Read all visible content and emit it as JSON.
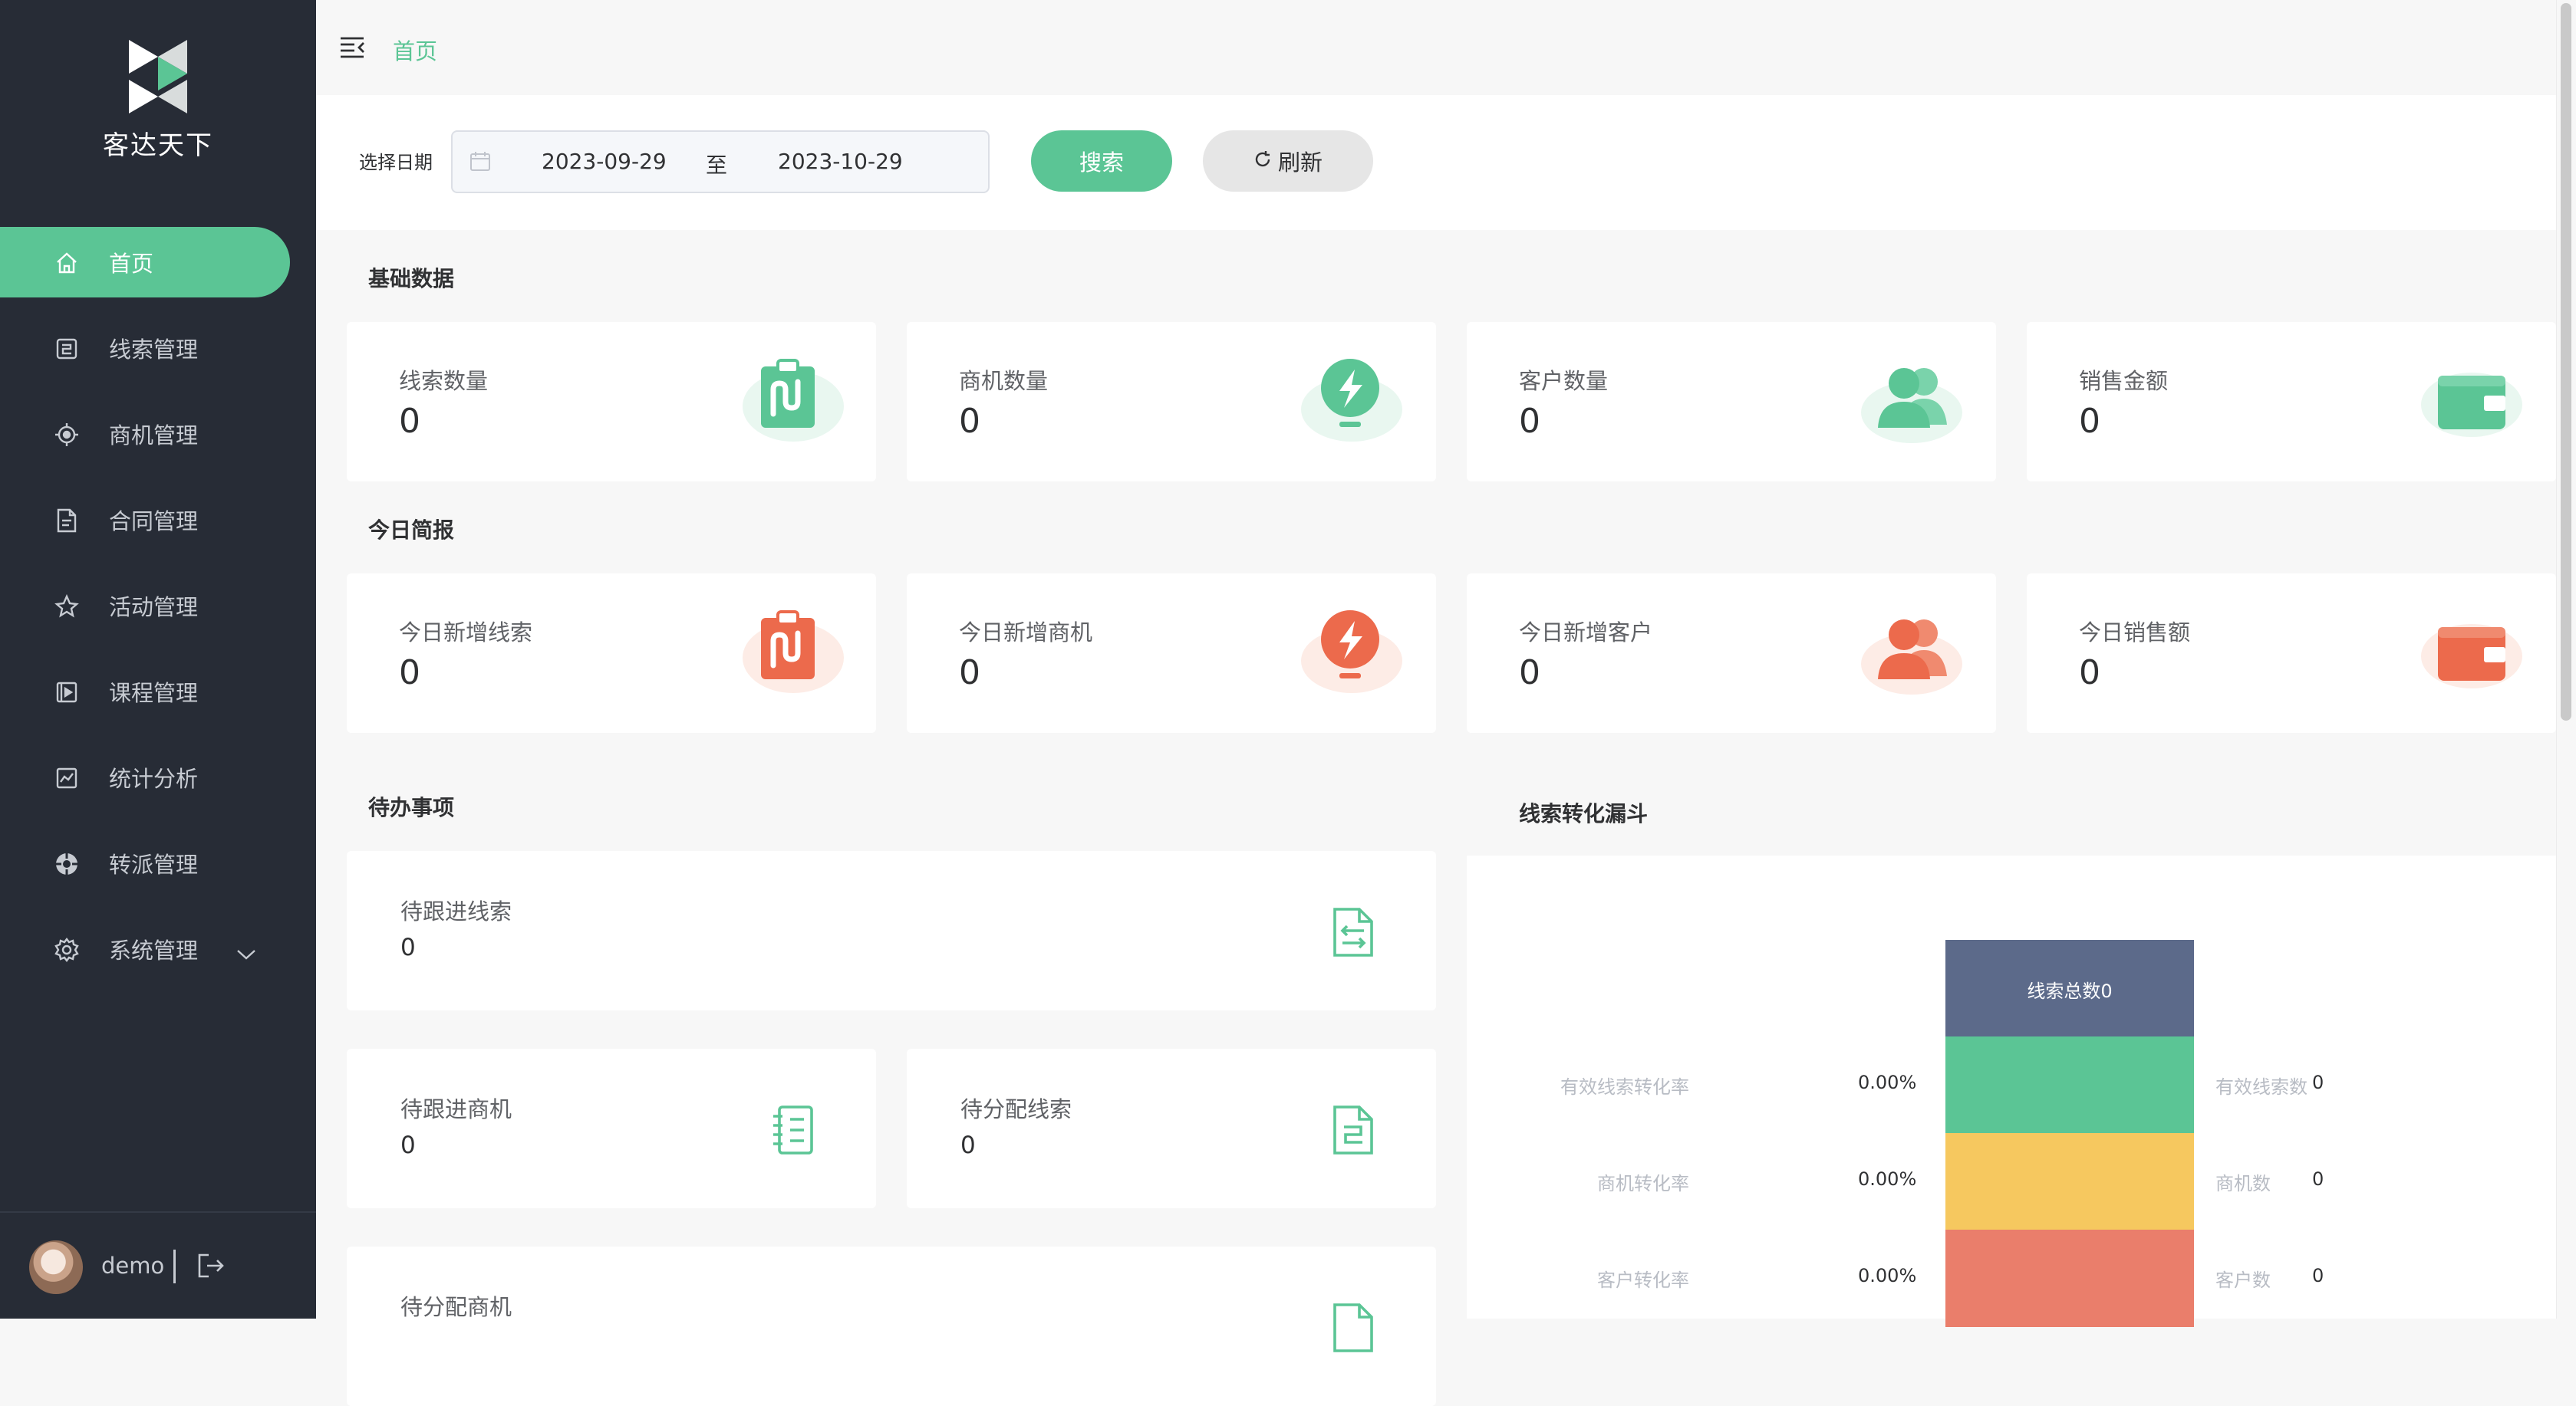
{
  "app": {
    "name": "客达天下"
  },
  "breadcrumb": {
    "current": "首页"
  },
  "sidebar": {
    "items": [
      {
        "label": "首页",
        "icon": "home-icon"
      },
      {
        "label": "线索管理",
        "icon": "clue-icon"
      },
      {
        "label": "商机管理",
        "icon": "target-icon"
      },
      {
        "label": "合同管理",
        "icon": "document-icon"
      },
      {
        "label": "活动管理",
        "icon": "star-icon"
      },
      {
        "label": "课程管理",
        "icon": "play-icon"
      },
      {
        "label": "统计分析",
        "icon": "chart-icon"
      },
      {
        "label": "转派管理",
        "icon": "transfer-icon"
      },
      {
        "label": "系统管理",
        "icon": "gear-icon"
      }
    ],
    "active_index": 0,
    "user": {
      "name": "demo"
    }
  },
  "filter": {
    "label": "选择日期",
    "start_date": "2023-09-29",
    "separator": "至",
    "end_date": "2023-10-29",
    "search_label": "搜索",
    "refresh_label": "刷新"
  },
  "basic": {
    "title": "基础数据",
    "cards": [
      {
        "label": "线索数量",
        "value": "0",
        "icon": "clipboard-icon"
      },
      {
        "label": "商机数量",
        "value": "0",
        "icon": "lightbulb-icon"
      },
      {
        "label": "客户数量",
        "value": "0",
        "icon": "users-icon"
      },
      {
        "label": "销售金额",
        "value": "0",
        "icon": "wallet-icon"
      }
    ]
  },
  "today": {
    "title": "今日简报",
    "cards": [
      {
        "label": "今日新增线索",
        "value": "0",
        "icon": "clipboard-icon"
      },
      {
        "label": "今日新增商机",
        "value": "0",
        "icon": "lightbulb-icon"
      },
      {
        "label": "今日新增客户",
        "value": "0",
        "icon": "users-icon"
      },
      {
        "label": "今日销售额",
        "value": "0",
        "icon": "wallet-icon"
      }
    ]
  },
  "todo": {
    "title": "待办事项",
    "items": [
      {
        "label": "待跟进线索",
        "value": "0",
        "icon": "file-transfer-icon"
      },
      {
        "label": "待跟进商机",
        "value": "0",
        "icon": "notebook-icon"
      },
      {
        "label": "待分配线索",
        "value": "0",
        "icon": "file-assign-icon"
      },
      {
        "label": "待分配商机",
        "value": "",
        "icon": "file-icon"
      }
    ]
  },
  "funnel": {
    "title": "线索转化漏斗",
    "top_label": "线索总数0",
    "rows": [
      {
        "left_label": "有效线索转化率",
        "rate": "0.00%",
        "right_label": "有效线索数",
        "count": "0"
      },
      {
        "left_label": "商机转化率",
        "rate": "0.00%",
        "right_label": "商机数",
        "count": "0"
      },
      {
        "left_label": "客户转化率",
        "rate": "0.00%",
        "right_label": "客户数",
        "count": "0"
      }
    ]
  },
  "colors": {
    "accent": "#5bc595",
    "sidebar_bg": "#272c36",
    "funnel_top": "#5c6a8a",
    "funnel_green": "#5bc595",
    "funnel_yellow": "#f6c85f",
    "funnel_red": "#ea7e6b",
    "today_icon": "#ec6a4c"
  }
}
